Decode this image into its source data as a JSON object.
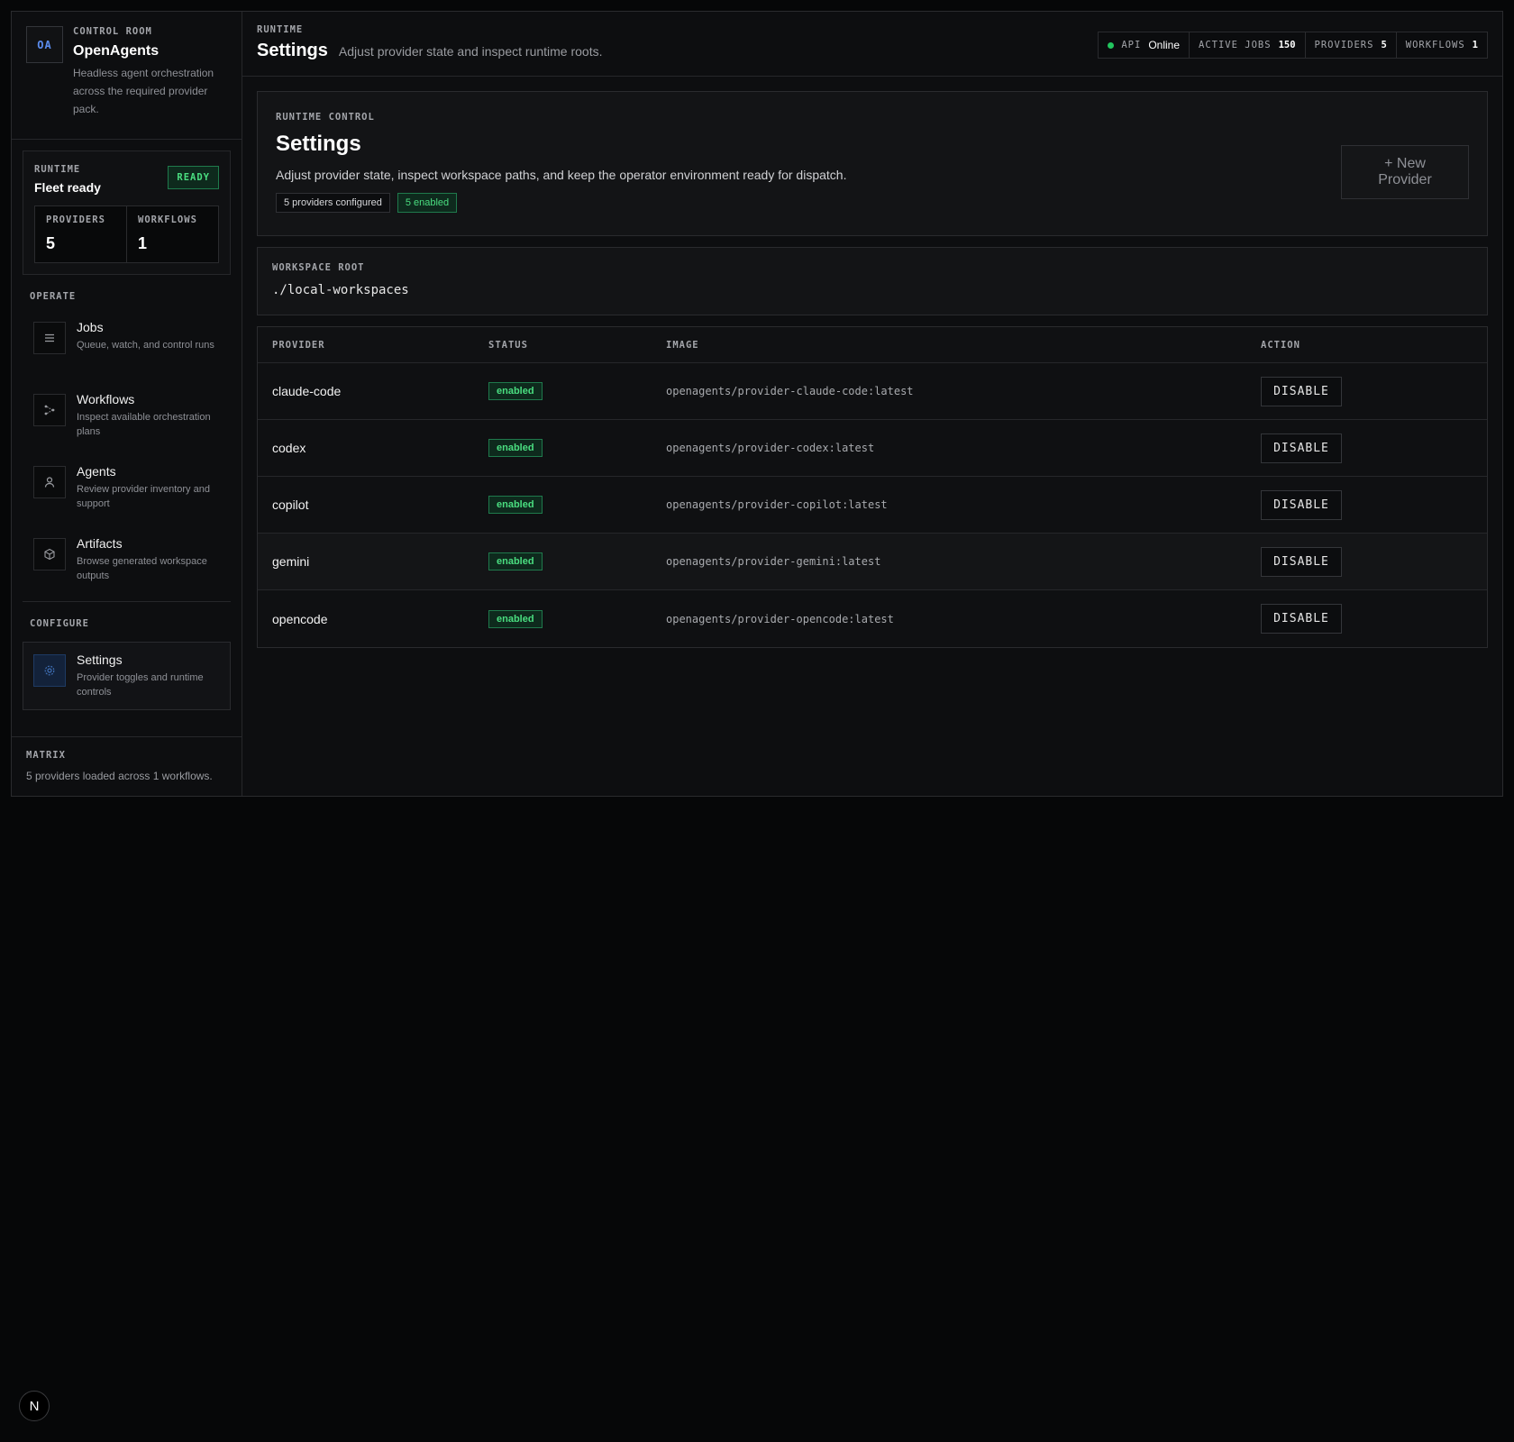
{
  "brand": {
    "logo": "OA",
    "eyebrow": "CONTROL ROOM",
    "name": "OpenAgents",
    "description": "Headless agent orchestration across the required provider pack."
  },
  "runtime": {
    "eyebrow": "RUNTIME",
    "title": "Fleet ready",
    "badge": "READY",
    "stats": [
      {
        "label": "PROVIDERS",
        "value": "5"
      },
      {
        "label": "WORKFLOWS",
        "value": "1"
      }
    ]
  },
  "operate": {
    "label": "OPERATE",
    "items": [
      {
        "title": "Jobs",
        "desc": "Queue, watch, and control runs",
        "icon": "list-icon"
      },
      {
        "title": "Workflows",
        "desc": "Inspect available orchestration plans",
        "icon": "workflow-icon"
      },
      {
        "title": "Agents",
        "desc": "Review provider inventory and support",
        "icon": "user-icon"
      },
      {
        "title": "Artifacts",
        "desc": "Browse generated workspace outputs",
        "icon": "cube-icon"
      }
    ]
  },
  "configure": {
    "label": "CONFIGURE",
    "items": [
      {
        "title": "Settings",
        "desc": "Provider toggles and runtime controls",
        "icon": "gear-icon"
      }
    ]
  },
  "matrix": {
    "label": "MATRIX",
    "text": "5 providers loaded across 1 workflows."
  },
  "topbar": {
    "eyebrow": "RUNTIME",
    "title": "Settings",
    "subtitle": "Adjust provider state and inspect runtime roots.",
    "status": {
      "api_label": "API",
      "api_value": "Online",
      "jobs_label": "ACTIVE JOBS",
      "jobs_value": "150",
      "providers_label": "PROVIDERS",
      "providers_value": "5",
      "workflows_label": "WORKFLOWS",
      "workflows_value": "1"
    }
  },
  "hero": {
    "eyebrow": "RUNTIME CONTROL",
    "title": "Settings",
    "description": "Adjust provider state, inspect workspace paths, and keep the operator environment ready for dispatch.",
    "chip_configured": "5 providers configured",
    "chip_enabled": "5 enabled",
    "new_provider": "+ New Provider"
  },
  "workspace": {
    "label": "WORKSPACE ROOT",
    "value": "./local-workspaces"
  },
  "table": {
    "columns": [
      "PROVIDER",
      "STATUS",
      "IMAGE",
      "ACTION"
    ],
    "rows": [
      {
        "provider": "claude-code",
        "status": "enabled",
        "image": "openagents/provider-claude-code:latest",
        "action": "DISABLE"
      },
      {
        "provider": "codex",
        "status": "enabled",
        "image": "openagents/provider-codex:latest",
        "action": "DISABLE"
      },
      {
        "provider": "copilot",
        "status": "enabled",
        "image": "openagents/provider-copilot:latest",
        "action": "DISABLE"
      },
      {
        "provider": "gemini",
        "status": "enabled",
        "image": "openagents/provider-gemini:latest",
        "action": "DISABLE"
      },
      {
        "provider": "opencode",
        "status": "enabled",
        "image": "openagents/provider-opencode:latest",
        "action": "DISABLE"
      }
    ]
  },
  "fab": {
    "label": "N"
  },
  "colors": {
    "accent_green": "#4ade80",
    "accent_blue": "#5b8def",
    "background": "#060708"
  }
}
